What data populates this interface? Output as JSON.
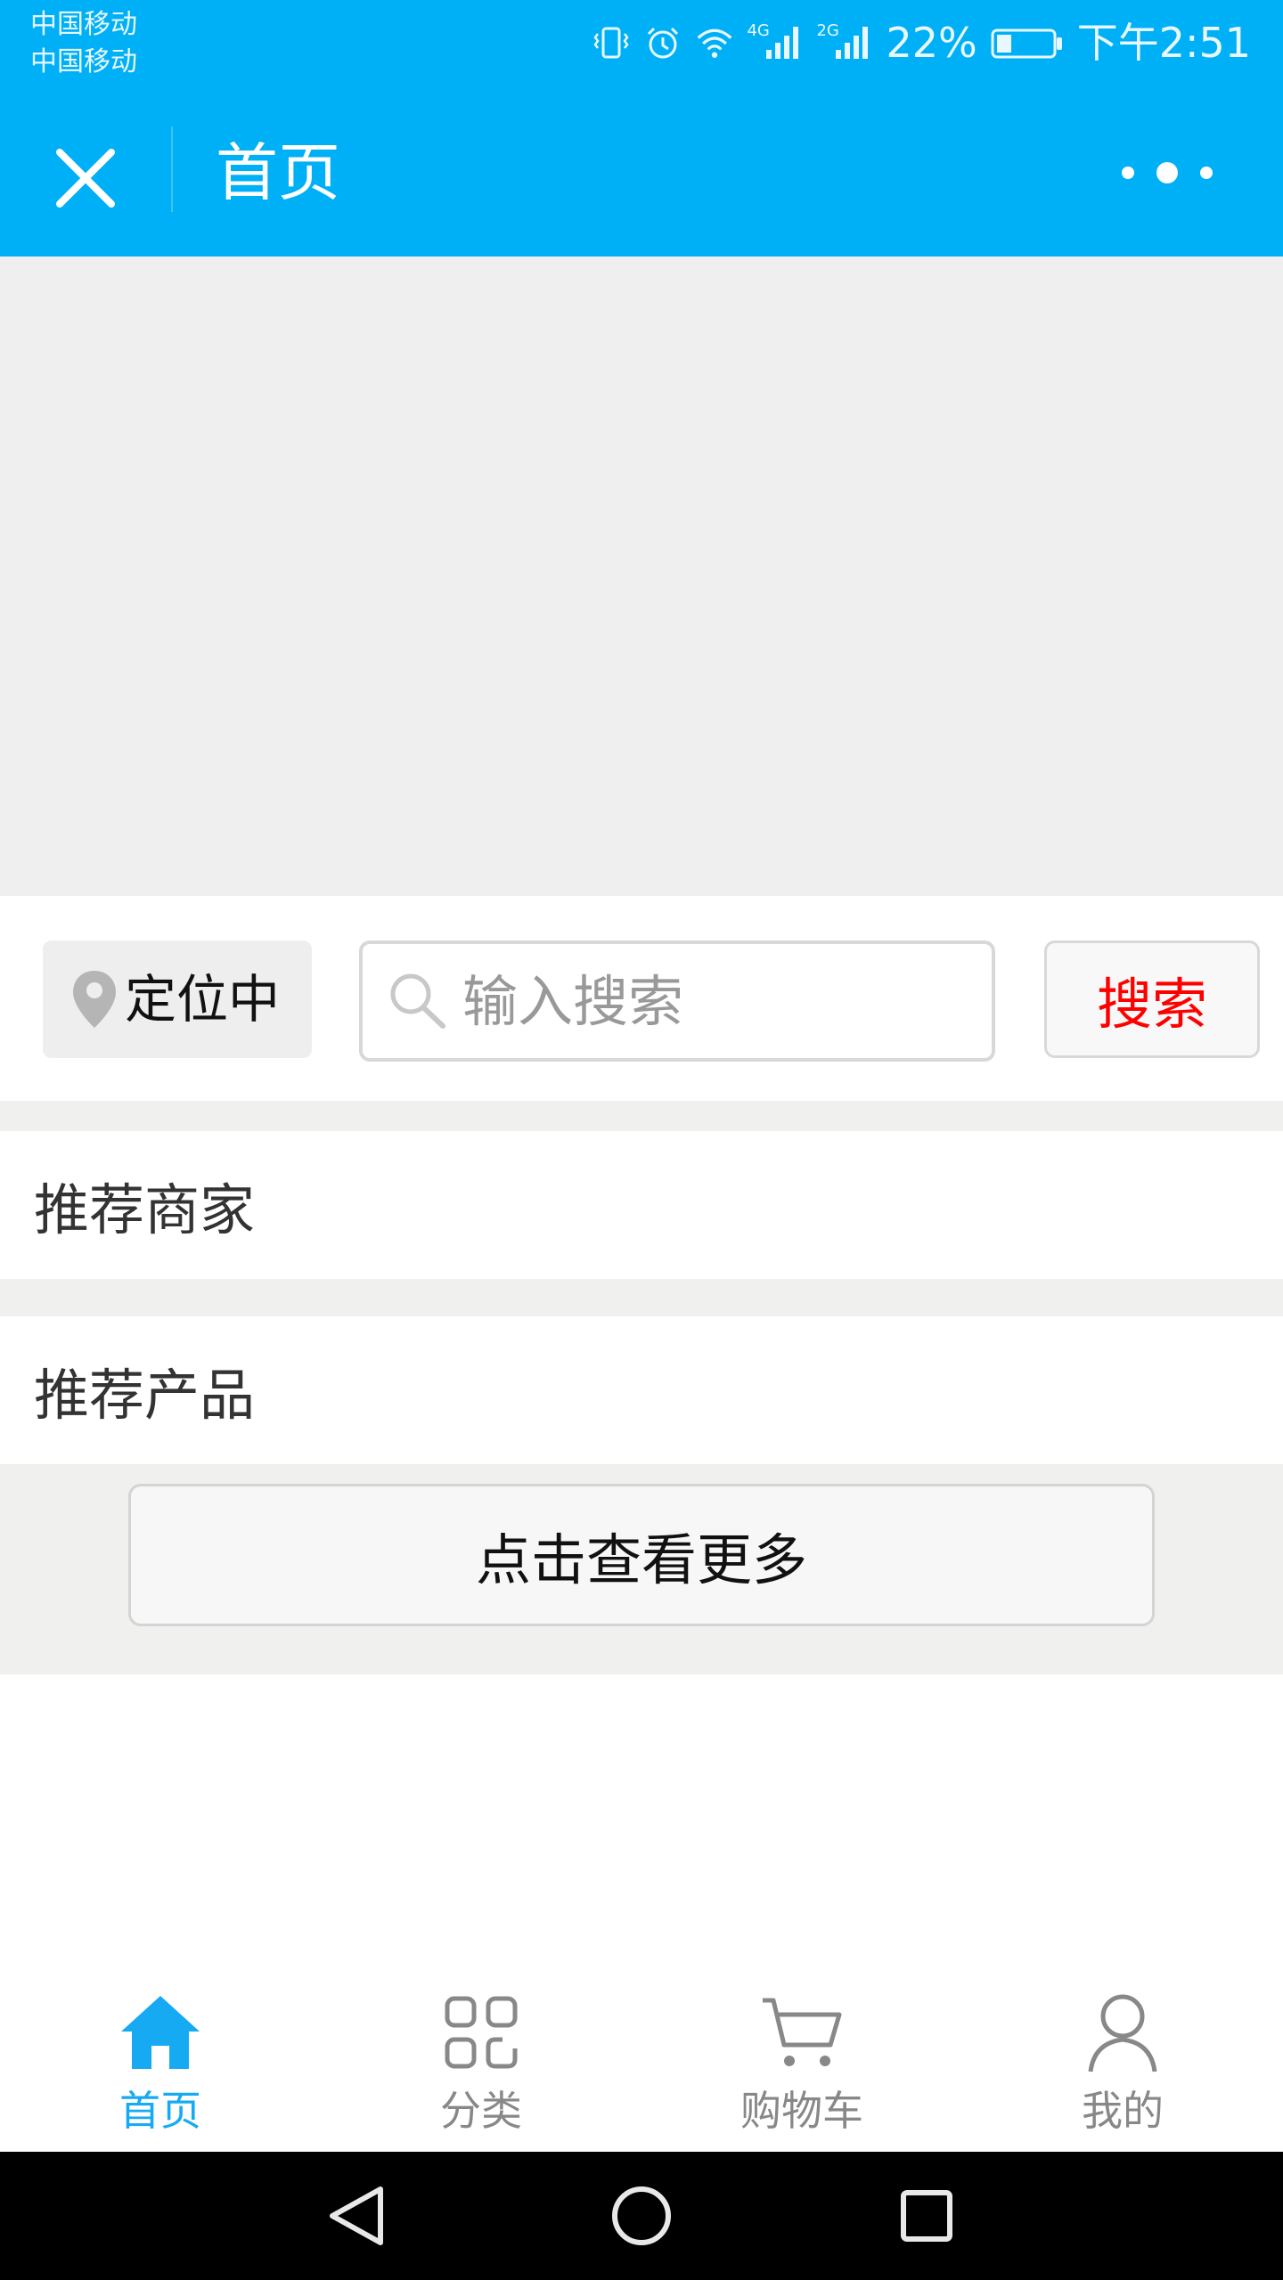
{
  "status_bar": {
    "carrier_1": "中国移动",
    "carrier_2": "中国移动",
    "net1": "4G",
    "net2": "2G",
    "battery": "22%",
    "time": "下午2:51",
    "icons": [
      "vibrate-icon",
      "alarm-icon",
      "wifi-icon",
      "signal-icon",
      "signal-icon",
      "battery-icon"
    ],
    "color": "#00b0f6"
  },
  "navbar": {
    "title": "首页",
    "close_icon": "close-icon",
    "more_icon": "more-icon"
  },
  "search": {
    "location_label": "定位中",
    "placeholder": "输入搜索",
    "button_label": "搜索",
    "button_color": "#ff0000"
  },
  "sections": {
    "recommended_merchants": "推荐商家",
    "recommended_products": "推荐产品"
  },
  "load_more_label": "点击查看更多",
  "tabbar": {
    "active_color": "#16aaf2",
    "items": [
      {
        "label": "首页",
        "icon": "home-icon",
        "active": true
      },
      {
        "label": "分类",
        "icon": "grid-icon",
        "active": false
      },
      {
        "label": "购物车",
        "icon": "cart-icon",
        "active": false
      },
      {
        "label": "我的",
        "icon": "user-icon",
        "active": false
      }
    ]
  },
  "system_nav": [
    "back-icon",
    "home-circle-icon",
    "recents-icon"
  ]
}
